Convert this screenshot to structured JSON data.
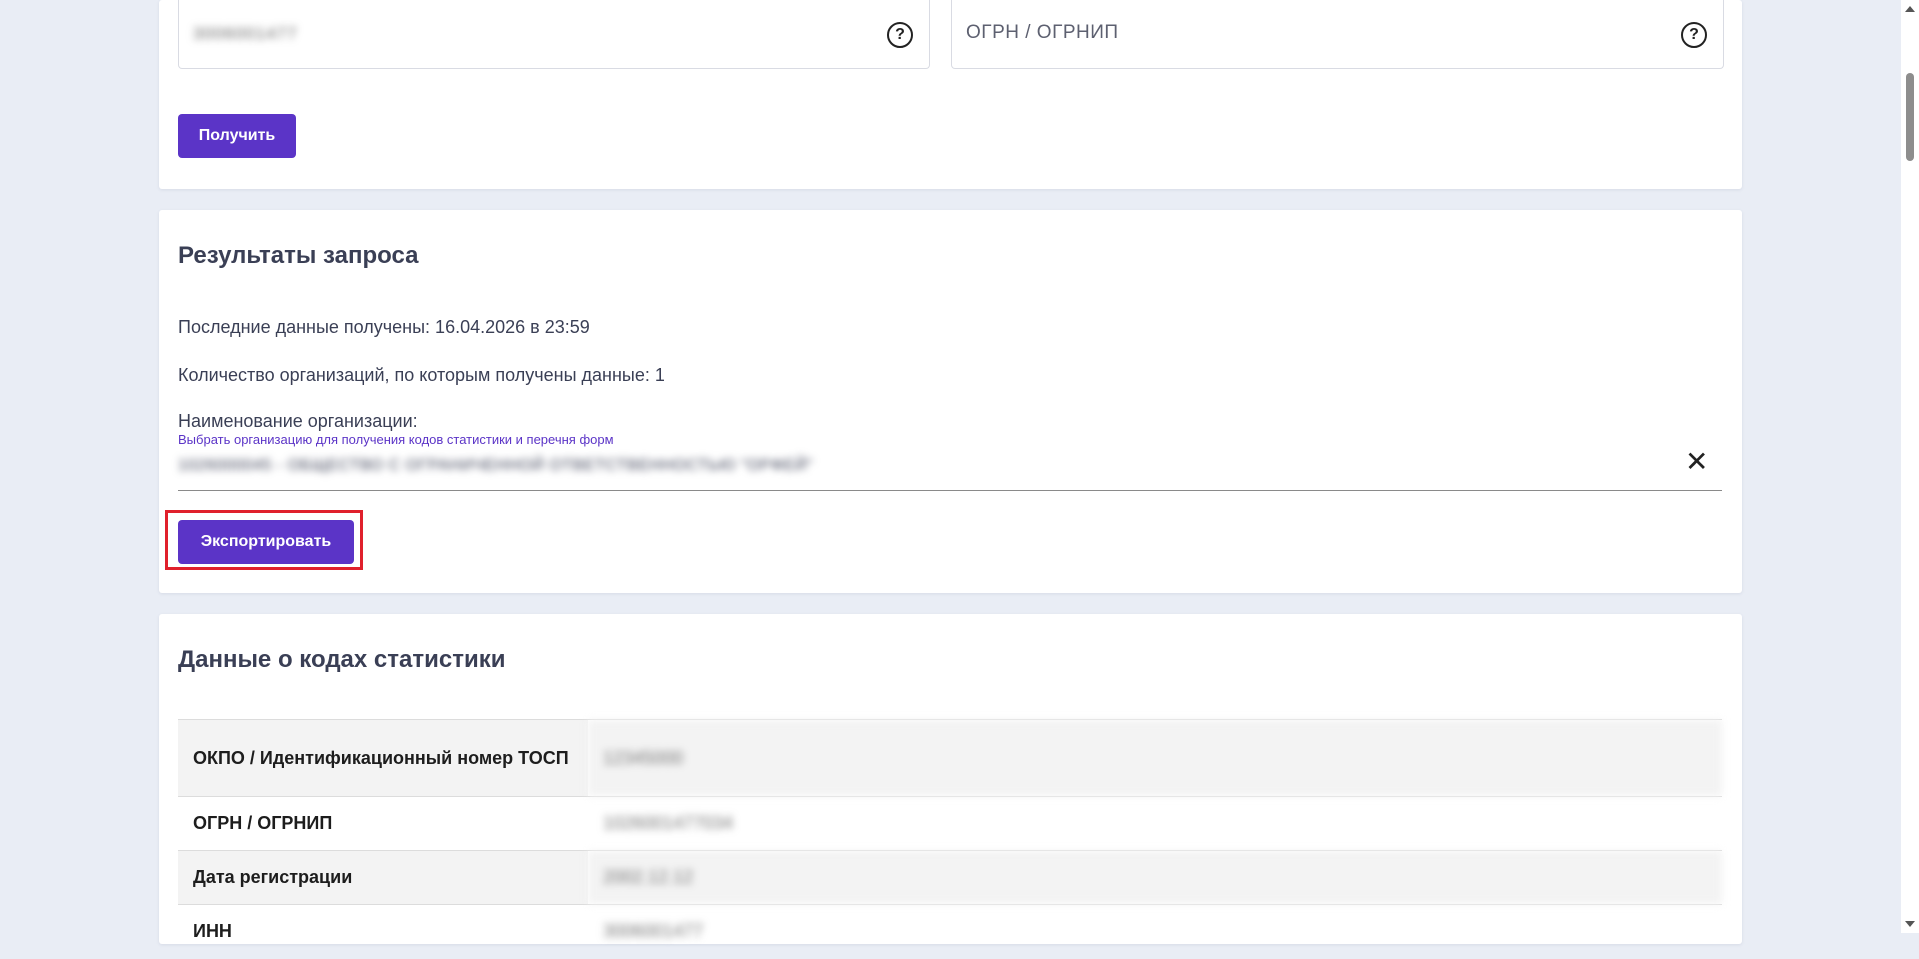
{
  "top_form": {
    "inn_value": "3006001477",
    "ogrn_placeholder": "ОГРН / ОГРНИП",
    "submit_label": "Получить"
  },
  "results": {
    "title": "Результаты запроса",
    "last_received": "Последние данные получены: 16.04.2026 в 23:59",
    "org_count": "Количество организаций, по которым получены данные: 1",
    "org_name_label": "Наименование организации:",
    "org_select_hint": "Выбрать организацию для получения кодов статистики и перечня форм",
    "org_selected": "1026000045 - ОБЩЕСТВО С ОГРАНИЧЕННОЙ ОТВЕТСТВЕННОСТЬЮ \"ОРФЕЙ\"",
    "export_label": "Экспортировать"
  },
  "codes": {
    "title": "Данные о кодах статистики",
    "rows": [
      {
        "label": "ОКПО / Идентификационный номер ТОСП",
        "value": "12345000"
      },
      {
        "label": "ОГРН / ОГРНИП",
        "value": "1026001477034"
      },
      {
        "label": "Дата регистрации",
        "value": "2002.12.12"
      },
      {
        "label": "ИНН",
        "value": "3006001477"
      }
    ]
  },
  "colors": {
    "accent": "#5b34c7",
    "highlight": "#e0202c",
    "background": "#e9edf5"
  }
}
